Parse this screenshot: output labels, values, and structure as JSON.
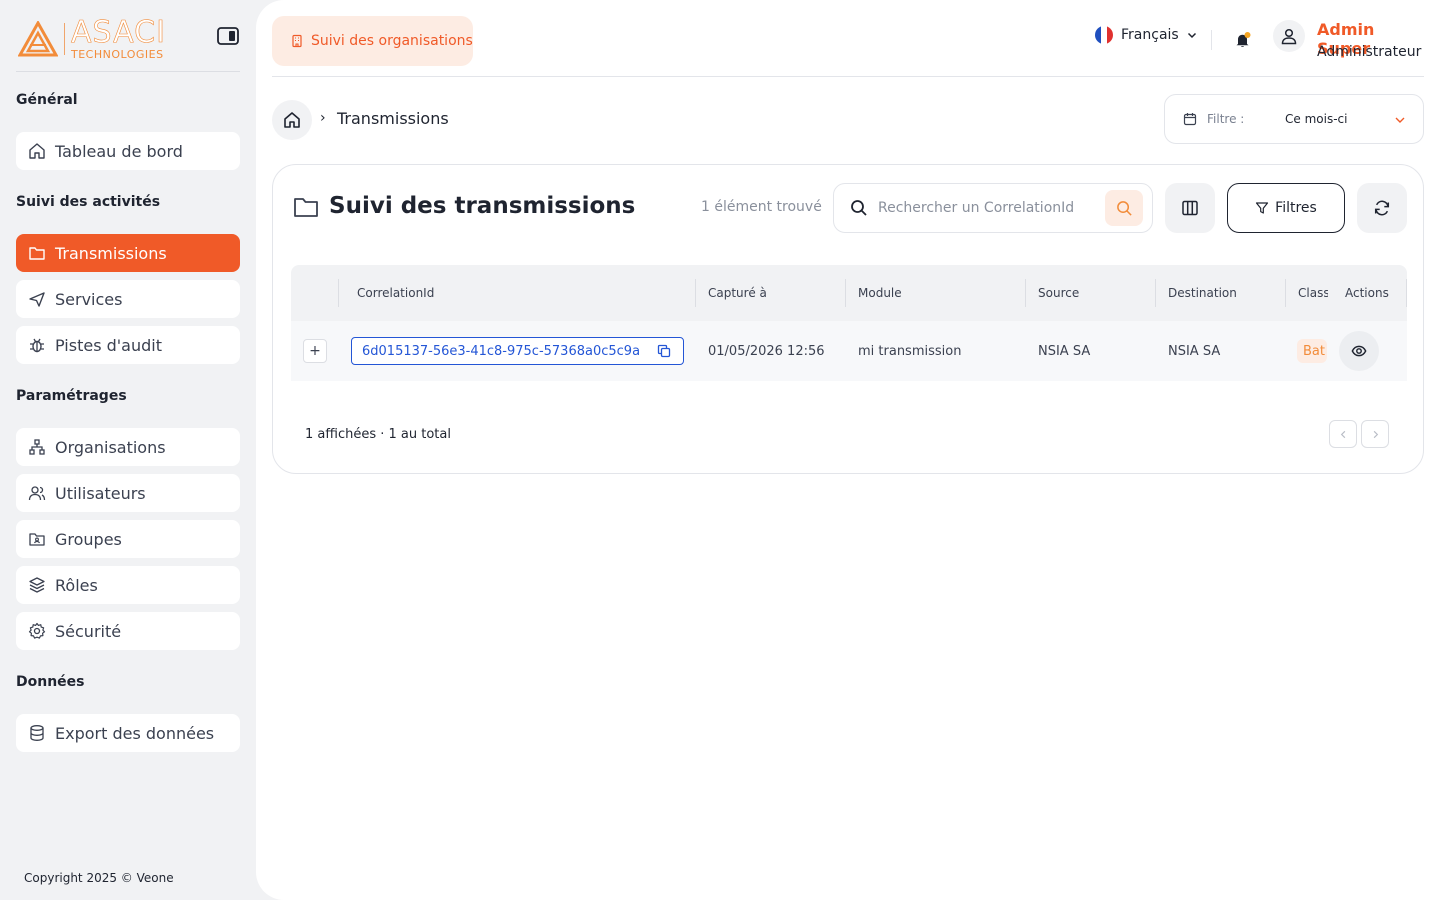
{
  "brand": {
    "name": "ASACI",
    "tagline": "TECHNOLOGIES"
  },
  "sidebar": {
    "sections": [
      {
        "title": "Général",
        "items": [
          {
            "label": "Tableau de bord",
            "icon": "home-icon"
          }
        ]
      },
      {
        "title": "Suivi des activités",
        "items": [
          {
            "label": "Transmissions",
            "icon": "folder-icon",
            "active": true
          },
          {
            "label": "Services",
            "icon": "send-icon"
          },
          {
            "label": "Pistes d'audit",
            "icon": "bug-icon"
          }
        ]
      },
      {
        "title": "Paramétrages",
        "items": [
          {
            "label": "Organisations",
            "icon": "org-chart-icon"
          },
          {
            "label": "Utilisateurs",
            "icon": "users-icon"
          },
          {
            "label": "Groupes",
            "icon": "folder-group-icon"
          },
          {
            "label": "Rôles",
            "icon": "layers-icon"
          },
          {
            "label": "Sécurité",
            "icon": "gear-icon"
          }
        ]
      },
      {
        "title": "Données",
        "items": [
          {
            "label": "Export des données",
            "icon": "database-icon"
          }
        ]
      }
    ],
    "copyright": "Copyright 2025 © Veone"
  },
  "topbar": {
    "org_link": "Suivi des organisations",
    "language": "Français",
    "user_name": "Admin Super",
    "user_role": "Administrateur"
  },
  "breadcrumb": {
    "current": "Transmissions"
  },
  "date_filter": {
    "label": "Filtre :",
    "value": "Ce mois-ci"
  },
  "card": {
    "title": "Suivi des transmissions",
    "found": "1 élément trouvé",
    "search_placeholder": "Rechercher un CorrelationId",
    "filters_label": "Filtres"
  },
  "table": {
    "columns": [
      "CorrelationId",
      "Capturé à",
      "Module",
      "Source",
      "Destination",
      "Class",
      "Actions"
    ],
    "rows": [
      {
        "correlation_id": "6d015137-56e3-41c8-975c-57368a0c5c9a",
        "captured_at": "01/05/2026 12:56",
        "module": "mi transmission",
        "source": "NSIA SA",
        "destination": "NSIA SA",
        "class": "Bat"
      }
    ]
  },
  "pagination": {
    "summary": "1 affichées · 1 au total"
  },
  "colors": {
    "accent": "#f05a28",
    "brand": "#f28c3a",
    "link": "#2456d6"
  }
}
